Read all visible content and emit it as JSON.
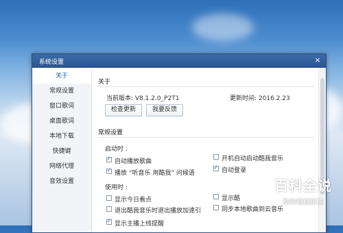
{
  "window": {
    "title": "系统设置",
    "close_glyph": "×"
  },
  "sidebar": {
    "items": [
      {
        "label": "关于",
        "active": true
      },
      {
        "label": "常规设置"
      },
      {
        "label": "窗口歌词"
      },
      {
        "label": "桌面歌词"
      },
      {
        "label": "本地下载"
      },
      {
        "label": "快捷键"
      },
      {
        "label": "网络代理"
      },
      {
        "label": "音效设置"
      }
    ]
  },
  "about": {
    "title": "关于",
    "version": "当前版本: V8.1.2.0_P2T1",
    "updated": "更新时间: 2016.2.23",
    "check_update": "检查更新",
    "feedback": "我要反馈"
  },
  "general": {
    "title": "常规设置",
    "startup_label": "启动时 :",
    "startup": [
      {
        "label": "自动播放歌曲",
        "checked": true
      },
      {
        "label": "开机自动启动酷我音乐",
        "checked": false
      },
      {
        "label": "播放 “听音乐 用酷我” 问候语",
        "checked": true
      },
      {
        "label": "自动登录",
        "checked": true
      }
    ],
    "usage_label": "使用时 :",
    "usage": [
      {
        "label": "显示今日看点",
        "checked": false
      },
      {
        "label": "显示酷",
        "checked": false
      },
      {
        "label": "退出酷我音乐时退出播放加速引",
        "checked": false
      },
      {
        "label": "同步本地歌曲到云音乐",
        "checked": false
      },
      {
        "label": "显示主播上线提醒",
        "checked": true
      }
    ]
  },
  "watermark": {
    "main": "百科全说",
    "sub": "助你轻松解决"
  }
}
